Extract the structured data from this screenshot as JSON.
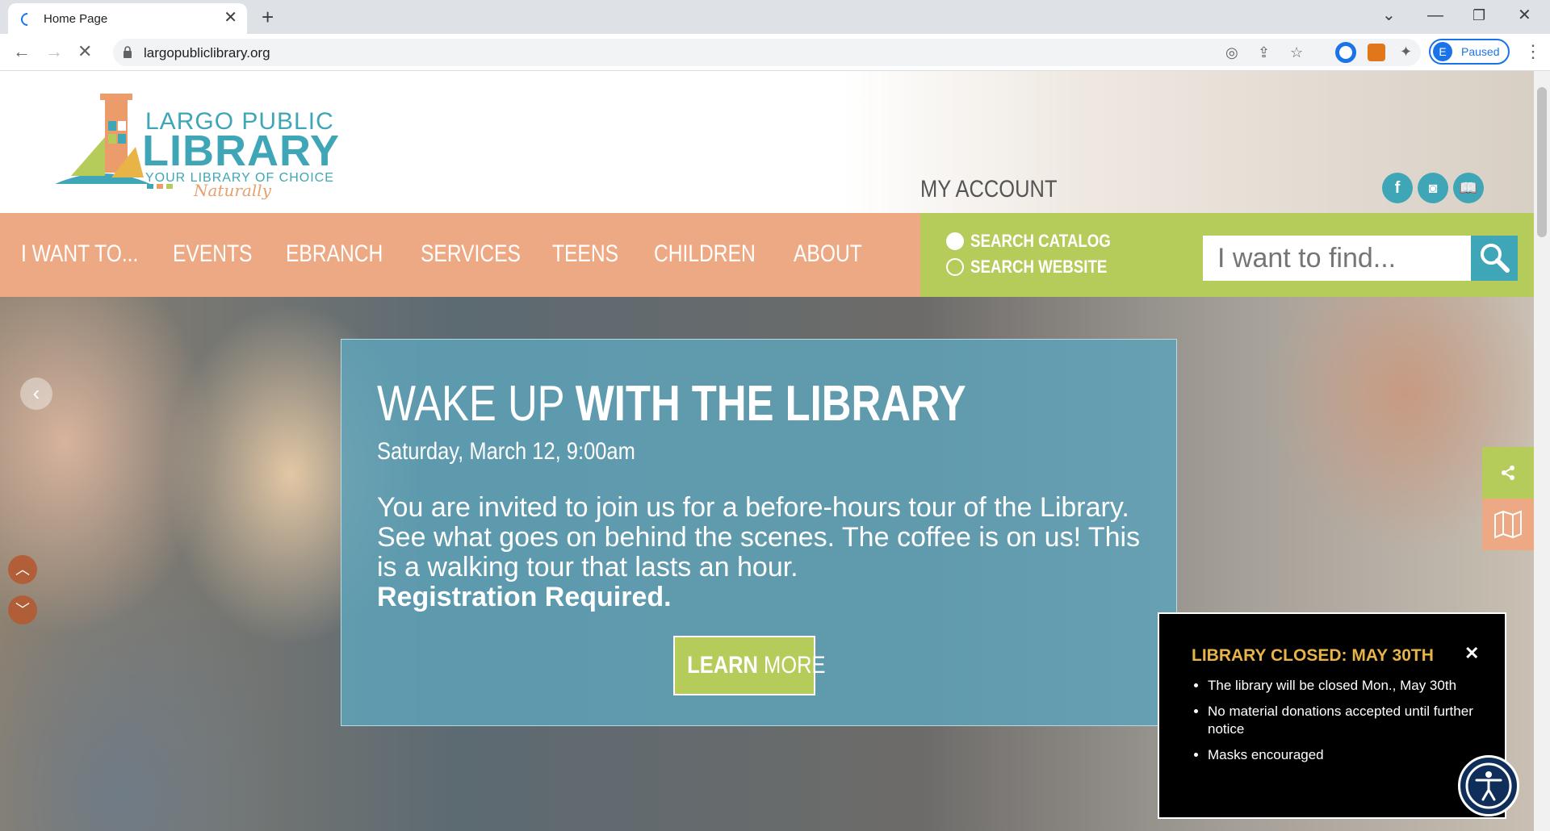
{
  "browser": {
    "tab_title": "Home Page",
    "url": "largopubliclibrary.org",
    "profile_initial": "E",
    "profile_status": "Paused"
  },
  "header": {
    "logo_line1": "LARGO PUBLIC",
    "logo_line2": "LIBRARY",
    "logo_line3": "YOUR LIBRARY OF CHOICE",
    "logo_line4": "Naturally",
    "my_account": "MY ACCOUNT",
    "social_icons": [
      "facebook-icon",
      "instagram-icon",
      "book-icon"
    ]
  },
  "nav": {
    "items": [
      "I WANT TO...",
      "EVENTS",
      "EBRANCH",
      "SERVICES",
      "TEENS",
      "CHILDREN",
      "ABOUT"
    ]
  },
  "search": {
    "option_catalog": "SEARCH CATALOG",
    "option_website": "SEARCH WEBSITE",
    "selected": "SEARCH CATALOG",
    "placeholder": "I want to find..."
  },
  "hero": {
    "title_light": "WAKE UP ",
    "title_bold": "WITH THE LIBRARY",
    "date": "Saturday, March 12, 9:00am",
    "description": "You are invited to join us for a before-hours tour of the Library. See what goes on behind the scenes. The coffee is on us! This is a walking tour that lasts an hour.",
    "description_bold": "Registration Required.",
    "button_bold": "LEARN",
    "button_light": " MORE"
  },
  "alert": {
    "title": "LIBRARY CLOSED: MAY 30TH",
    "items": [
      "The library will be closed Mon., May 30th",
      "No material donations accepted until further notice",
      "Masks encouraged"
    ]
  },
  "colors": {
    "nav_orange": "#eda983",
    "search_green": "#b5cc5a",
    "brand_teal": "#3ea6b6",
    "alert_gold": "#e8b447"
  }
}
